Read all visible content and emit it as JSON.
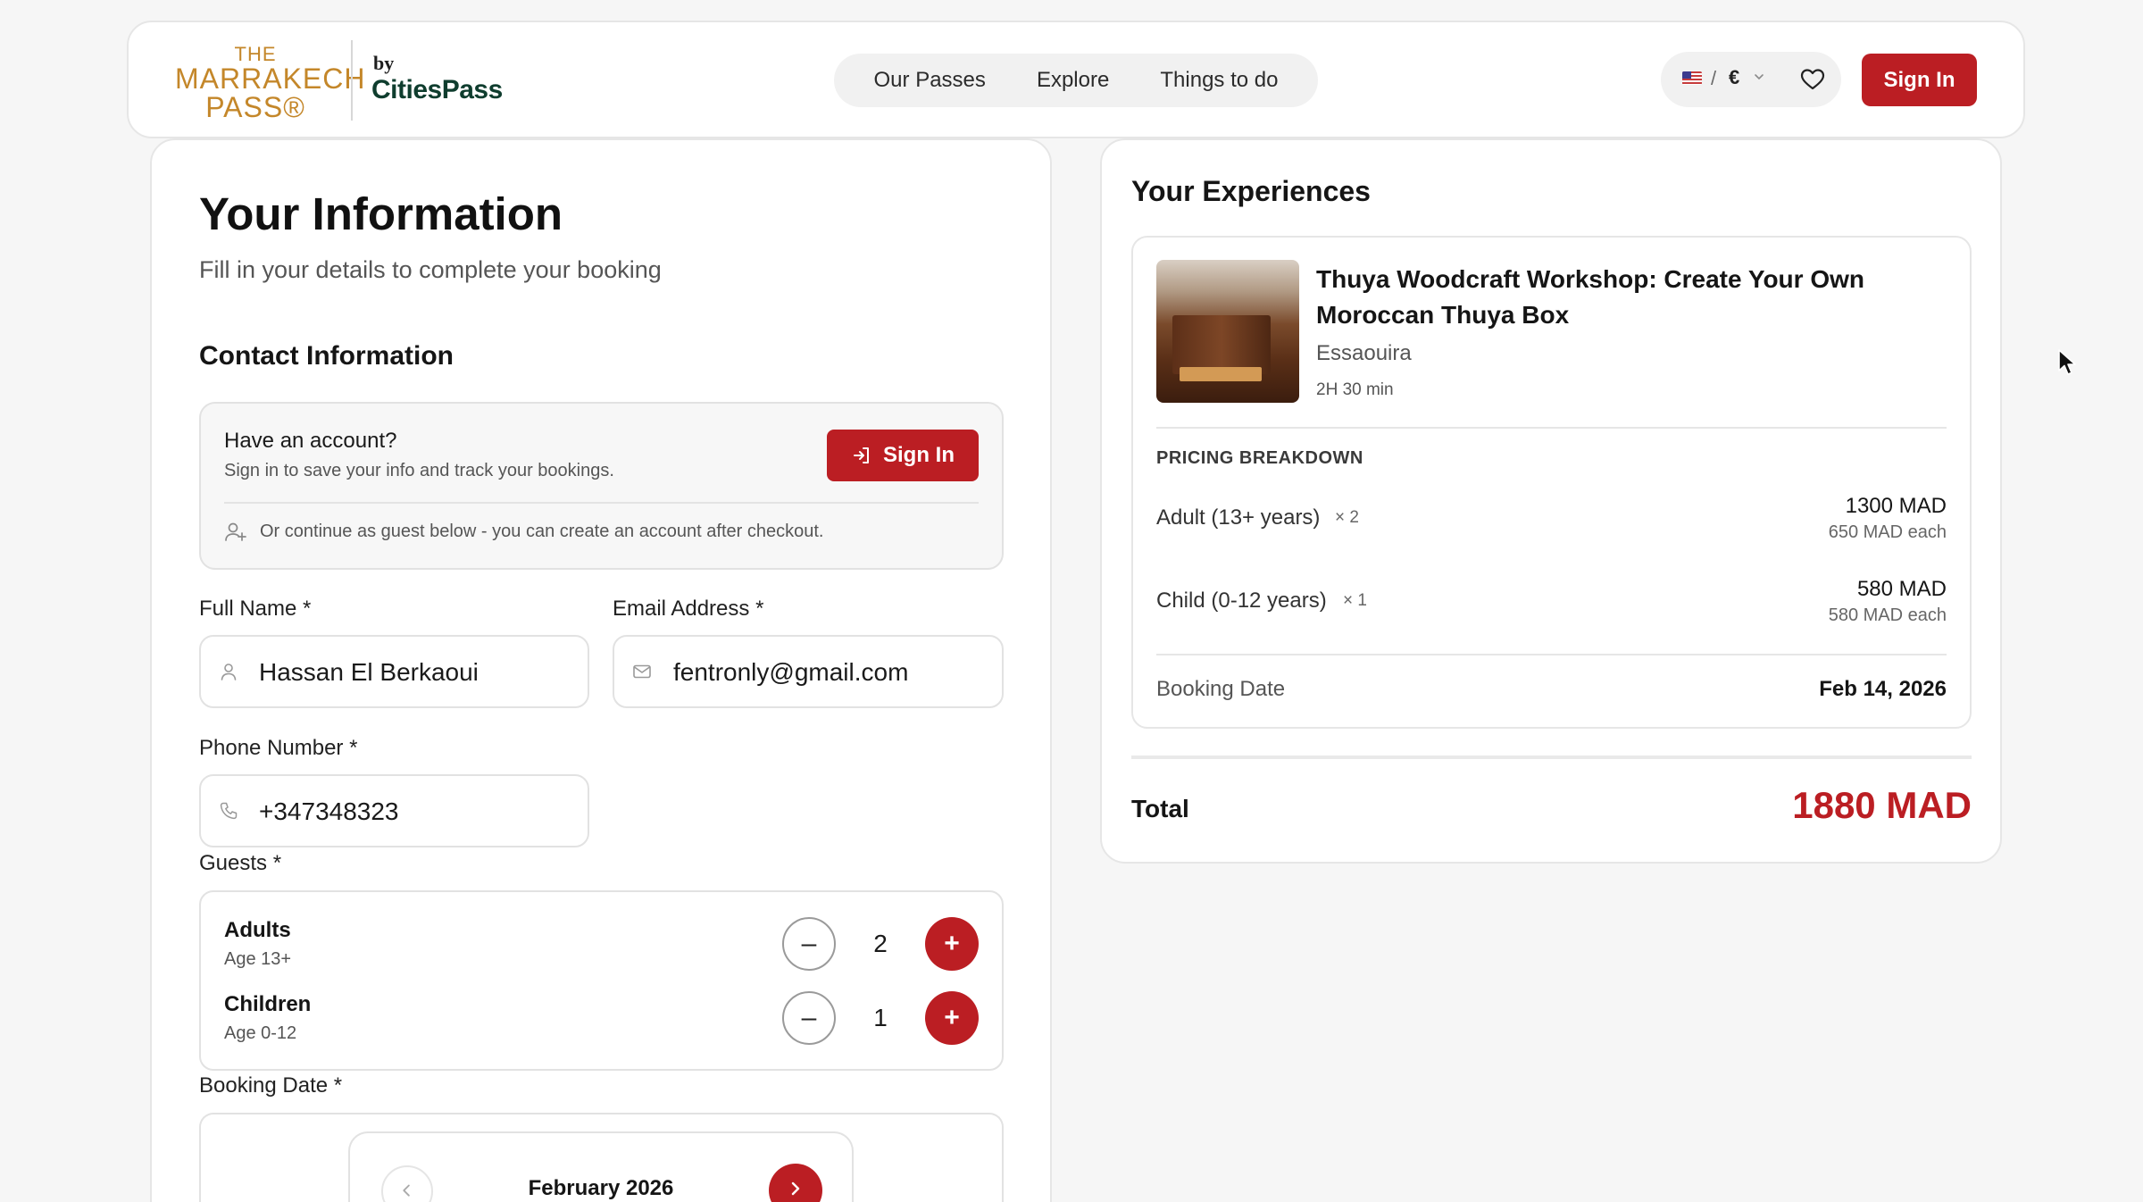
{
  "header": {
    "logo": {
      "line1": "THE",
      "line2": "MARRAKECH",
      "line3": "PASS®",
      "by": "by",
      "brand": "CitiesPass"
    },
    "nav": [
      {
        "label": "Our Passes"
      },
      {
        "label": "Explore"
      },
      {
        "label": "Things to do"
      }
    ],
    "prefs": {
      "separator": "/",
      "currency": "€",
      "flag_icon": "us-flag-icon"
    },
    "signin_label": "Sign In"
  },
  "left": {
    "title": "Your Information",
    "subtitle": "Fill in your details to complete your booking",
    "contact_title": "Contact Information",
    "account": {
      "title": "Have an account?",
      "subtitle": "Sign in to save your info and track your bookings.",
      "signin_label": "Sign In",
      "guest_note": "Or continue as guest below - you can create an account after checkout."
    },
    "fields": {
      "full_name_label": "Full Name *",
      "full_name_value": "Hassan El Berkaoui",
      "email_label": "Email Address *",
      "email_value": "fentronly@gmail.com",
      "phone_label": "Phone Number *",
      "phone_value": "+347348323"
    },
    "guests": {
      "label": "Guests *",
      "adults": {
        "title": "Adults",
        "sub": "Age 13+",
        "count": "2"
      },
      "children": {
        "title": "Children",
        "sub": "Age 0-12",
        "count": "1"
      },
      "minus": "–",
      "plus": "+"
    },
    "booking_date": {
      "label": "Booking Date *",
      "month": "February 2026"
    }
  },
  "right": {
    "heading": "Your Experiences",
    "experience": {
      "title": "Thuya Woodcraft Workshop: Create Your Own Moroccan Thuya Box",
      "location": "Essaouira",
      "duration": "2H 30 min"
    },
    "pricing_title": "PRICING BREAKDOWN",
    "rows": [
      {
        "label": "Adult (13+ years)",
        "mult": "× 2",
        "amount": "1300 MAD",
        "each": "650 MAD each"
      },
      {
        "label": "Child (0-12 years)",
        "mult": "× 1",
        "amount": "580 MAD",
        "each": "580 MAD each"
      }
    ],
    "booking_date_label": "Booking Date",
    "booking_date_value": "Feb 14, 2026",
    "total_label": "Total",
    "total_value": "1880 MAD"
  },
  "colors": {
    "accent": "#bb1e23",
    "logo_gold": "#c4872a",
    "brand_green": "#0f3d2e"
  }
}
